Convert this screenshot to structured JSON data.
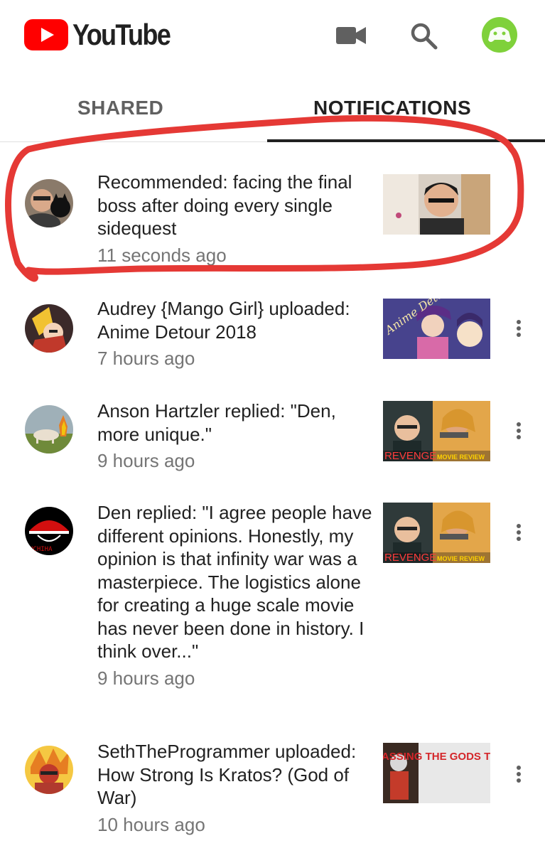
{
  "header": {
    "logo_text": "YouTube",
    "icons": [
      "video-camera-icon",
      "search-icon",
      "account-avatar"
    ],
    "accent_color": "#ff0000"
  },
  "tabs": [
    {
      "label": "SHARED",
      "selected": false
    },
    {
      "label": "NOTIFICATIONS",
      "selected": true
    }
  ],
  "notifications": [
    {
      "text": "Recommended: facing the final boss after doing every single sidequest",
      "time": "11 seconds ago",
      "highlighted": true
    },
    {
      "text": "Audrey {Mango Girl} uploaded: Anime Detour 2018",
      "time": "7 hours ago",
      "thumb_text": "Anime Detour"
    },
    {
      "text": "Anson Hartzler replied: \"Den, more unique.\"",
      "time": "9 hours ago",
      "thumb_text": "REVENGE",
      "thumb_sub": "MOVIE REVIEW"
    },
    {
      "text": "Den replied: \"I agree people have different opinions. Honestly, my opinion is that infinity war was a masterpiece. The logistics alone for creating a huge scale movie has never been done in history. I think over...\"",
      "time": "9 hours ago",
      "thumb_text": "REVENGE",
      "thumb_sub": "MOVIE REVIEW"
    },
    {
      "text": "SethTheProgrammer uploaded: How Strong Is Kratos? (God of War)",
      "time": "10 hours ago",
      "thumb_text": "SURPASSING THE GODS THEMSELVES"
    }
  ],
  "annotation_color": "#e53935"
}
